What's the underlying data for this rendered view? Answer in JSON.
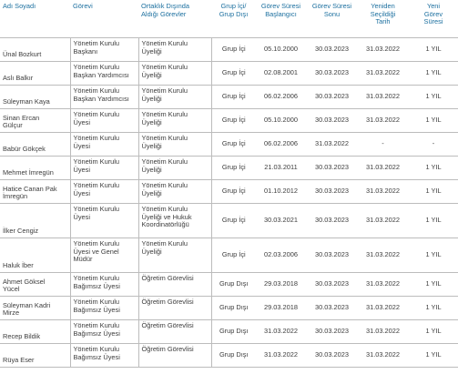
{
  "headers": {
    "name": "Adı Soyadı",
    "gorev": "Görevi",
    "ortak": "Ortaklık Dışında\nAldığı Görevler",
    "grup": "Grup İçi/\nGrup Dışı",
    "baslangic": "Görev Süresi\nBaşlangıcı",
    "sonu": "Görev Süresi\nSonu",
    "yeniden": "Yeniden\nSeçildiği\nTarih",
    "yeni_sure": "Yeni\nGörev\nSüresi"
  },
  "rows": [
    {
      "name": "Ünal Bozkurt",
      "gorev": "Yönetim Kurulu\nBaşkanı",
      "ortak": "Yönetim Kurulu\nÜyeliği",
      "grup": "Grup İçi",
      "baslangic": "05.10.2000",
      "sonu": "30.03.2023",
      "yeniden": "31.03.2022",
      "yeni_sure": "1 YIL"
    },
    {
      "name": "Aslı Balkır",
      "gorev": "Yönetim Kurulu\nBaşkan Yardımcısı",
      "ortak": "Yönetim Kurulu\nÜyeliği",
      "grup": "Grup İçi",
      "baslangic": "02.08.2001",
      "sonu": "30.03.2023",
      "yeniden": "31.03.2022",
      "yeni_sure": "1 YIL"
    },
    {
      "name": "Süleyman Kaya",
      "gorev": "Yönetim Kurulu\nBaşkan Yardımcısı",
      "ortak": "Yönetim Kurulu\nÜyeliği",
      "grup": "Grup İçi",
      "baslangic": "06.02.2006",
      "sonu": "30.03.2023",
      "yeniden": "31.03.2022",
      "yeni_sure": "1 YIL"
    },
    {
      "name": "Sinan Ercan\nGülçur",
      "gorev": "Yönetim Kurulu\nÜyesi",
      "ortak": "Yönetim Kurulu\nÜyeliği",
      "grup": "Grup İçi",
      "baslangic": "05.10.2000",
      "sonu": "30.03.2023",
      "yeniden": "31.03.2022",
      "yeni_sure": "1 YIL"
    },
    {
      "name": "Babür Gökçek",
      "gorev": "Yönetim Kurulu\nÜyesi",
      "ortak": "Yönetim Kurulu\nÜyeliği",
      "grup": "Grup İçi",
      "baslangic": "06.02.2006",
      "sonu": "31.03.2022",
      "yeniden": "-",
      "yeni_sure": "-"
    },
    {
      "name": "Mehmet İmregün",
      "gorev": "Yönetim Kurulu\nÜyesi",
      "ortak": "Yönetim Kurulu\nÜyeliği",
      "grup": "Grup İçi",
      "baslangic": "21.03.2011",
      "sonu": "30.03.2023",
      "yeniden": "31.03.2022",
      "yeni_sure": "1 YIL"
    },
    {
      "name": "Hatice Canan Pak\nİmregün",
      "gorev": "Yönetim Kurulu\nÜyesi",
      "ortak": "Yönetim Kurulu\nÜyeliği",
      "grup": "Grup İçi",
      "baslangic": "01.10.2012",
      "sonu": "30.03.2023",
      "yeniden": "31.03.2022",
      "yeni_sure": "1 YIL"
    },
    {
      "name": "İlker Cengiz",
      "gorev": "Yönetim Kurulu\nÜyesi",
      "ortak": "Yönetim Kurulu\nÜyeliği ve Hukuk\nKoordinatörlüğü",
      "grup": "Grup İçi",
      "baslangic": "30.03.2021",
      "sonu": "30.03.2023",
      "yeniden": "31.03.2022",
      "yeni_sure": "1 YIL"
    },
    {
      "name": "Haluk İber",
      "gorev": "Yönetim Kurulu\nÜyesi ve Genel\nMüdür",
      "ortak": "Yönetim Kurulu\nÜyeliği",
      "grup": "Grup İçi",
      "baslangic": "02.03.2006",
      "sonu": "30.03.2023",
      "yeniden": "31.03.2022",
      "yeni_sure": "1 YIL"
    },
    {
      "name": "Ahmet Göksel\nYücel",
      "gorev": "Yönetim Kurulu\nBağımsız Üyesi",
      "ortak": "Öğretim Görevlisi",
      "grup": "Grup Dışı",
      "baslangic": "29.03.2018",
      "sonu": "30.03.2023",
      "yeniden": "31.03.2022",
      "yeni_sure": "1 YIL"
    },
    {
      "name": "Süleyman Kadri\nMirze",
      "gorev": "Yönetim Kurulu\nBağımsız Üyesi",
      "ortak": "Öğretim Görevlisi",
      "grup": "Grup Dışı",
      "baslangic": "29.03.2018",
      "sonu": "30.03.2023",
      "yeniden": "31.03.2022",
      "yeni_sure": "1 YIL"
    },
    {
      "name": "Recep Bildik",
      "gorev": "Yönetim Kurulu\nBağımsız Üyesi",
      "ortak": "Öğretim Görevlisi",
      "grup": "Grup Dışı",
      "baslangic": "31.03.2022",
      "sonu": "30.03.2023",
      "yeniden": "31.03.2022",
      "yeni_sure": "1 YIL"
    },
    {
      "name": "Rüya Eser",
      "gorev": "Yönetim Kurulu\nBağımsız Üyesi",
      "ortak": "Öğretim Görevlisi",
      "grup": "Grup Dışı",
      "baslangic": "31.03.2022",
      "sonu": "30.03.2023",
      "yeniden": "31.03.2022",
      "yeni_sure": "1 YIL"
    }
  ]
}
